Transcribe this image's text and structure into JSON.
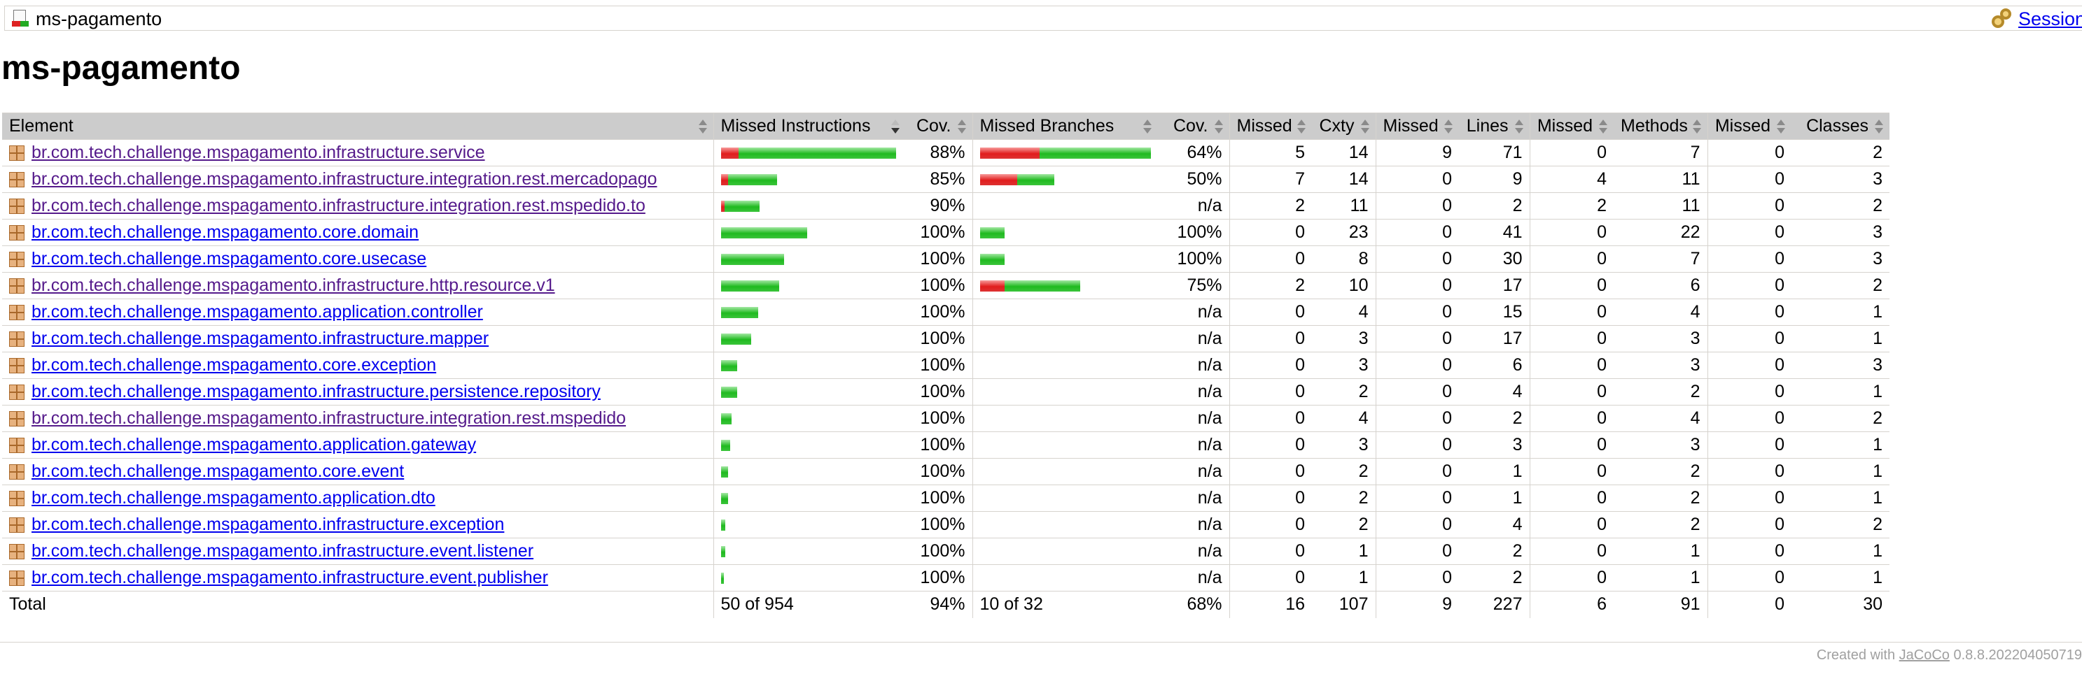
{
  "breadcrumb": {
    "title": "ms-pagamento",
    "sessions_link": "Sessions"
  },
  "page_title": "ms-pagamento",
  "table": {
    "headers": [
      "Element",
      "Missed Instructions",
      "Cov.",
      "Missed Branches",
      "Cov.",
      "Missed",
      "Cxty",
      "Missed",
      "Lines",
      "Missed",
      "Methods",
      "Missed",
      "Classes"
    ],
    "rows": [
      {
        "name": "br.com.tech.challenge.mspagamento.infrastructure.service",
        "visited": true,
        "instr_red": 0.099,
        "instr_green": 0.901,
        "instr_cov": "88%",
        "br_red": 0.35,
        "br_green": 0.65,
        "br_cov": "64%",
        "cxty_missed": "5",
        "cxty": "14",
        "lines_missed": "9",
        "lines": "71",
        "methods_missed": "0",
        "methods": "7",
        "classes_missed": "0",
        "classes": "2"
      },
      {
        "name": "br.com.tech.challenge.mspagamento.infrastructure.integration.rest.mercadopago",
        "visited": true,
        "instr_red": 0.04,
        "instr_green": 0.28,
        "instr_cov": "85%",
        "br_red": 0.21,
        "br_green": 0.21,
        "br_cov": "50%",
        "cxty_missed": "7",
        "cxty": "14",
        "lines_missed": "0",
        "lines": "9",
        "methods_missed": "4",
        "methods": "11",
        "classes_missed": "0",
        "classes": "3"
      },
      {
        "name": "br.com.tech.challenge.mspagamento.infrastructure.integration.rest.mspedido.to",
        "visited": true,
        "instr_red": 0.02,
        "instr_green": 0.2,
        "instr_cov": "90%",
        "br_red": 0,
        "br_green": 0,
        "br_cov": "n/a",
        "cxty_missed": "2",
        "cxty": "11",
        "lines_missed": "0",
        "lines": "2",
        "methods_missed": "2",
        "methods": "11",
        "classes_missed": "0",
        "classes": "2"
      },
      {
        "name": "br.com.tech.challenge.mspagamento.core.domain",
        "visited": false,
        "instr_red": 0,
        "instr_green": 0.49,
        "instr_cov": "100%",
        "br_red": 0,
        "br_green": 0.14,
        "br_cov": "100%",
        "cxty_missed": "0",
        "cxty": "23",
        "lines_missed": "0",
        "lines": "41",
        "methods_missed": "0",
        "methods": "22",
        "classes_missed": "0",
        "classes": "3"
      },
      {
        "name": "br.com.tech.challenge.mspagamento.core.usecase",
        "visited": false,
        "instr_red": 0,
        "instr_green": 0.36,
        "instr_cov": "100%",
        "br_red": 0,
        "br_green": 0.14,
        "br_cov": "100%",
        "cxty_missed": "0",
        "cxty": "8",
        "lines_missed": "0",
        "lines": "30",
        "methods_missed": "0",
        "methods": "7",
        "classes_missed": "0",
        "classes": "3"
      },
      {
        "name": "br.com.tech.challenge.mspagamento.infrastructure.http.resource.v1",
        "visited": true,
        "instr_red": 0,
        "instr_green": 0.33,
        "instr_cov": "100%",
        "br_red": 0.14,
        "br_green": 0.43,
        "br_cov": "75%",
        "cxty_missed": "2",
        "cxty": "10",
        "lines_missed": "0",
        "lines": "17",
        "methods_missed": "0",
        "methods": "6",
        "classes_missed": "0",
        "classes": "2"
      },
      {
        "name": "br.com.tech.challenge.mspagamento.application.controller",
        "visited": false,
        "instr_red": 0,
        "instr_green": 0.21,
        "instr_cov": "100%",
        "br_red": 0,
        "br_green": 0,
        "br_cov": "n/a",
        "cxty_missed": "0",
        "cxty": "4",
        "lines_missed": "0",
        "lines": "15",
        "methods_missed": "0",
        "methods": "4",
        "classes_missed": "0",
        "classes": "1"
      },
      {
        "name": "br.com.tech.challenge.mspagamento.infrastructure.mapper",
        "visited": false,
        "instr_red": 0,
        "instr_green": 0.17,
        "instr_cov": "100%",
        "br_red": 0,
        "br_green": 0,
        "br_cov": "n/a",
        "cxty_missed": "0",
        "cxty": "3",
        "lines_missed": "0",
        "lines": "17",
        "methods_missed": "0",
        "methods": "3",
        "classes_missed": "0",
        "classes": "1"
      },
      {
        "name": "br.com.tech.challenge.mspagamento.core.exception",
        "visited": false,
        "instr_red": 0,
        "instr_green": 0.09,
        "instr_cov": "100%",
        "br_red": 0,
        "br_green": 0,
        "br_cov": "n/a",
        "cxty_missed": "0",
        "cxty": "3",
        "lines_missed": "0",
        "lines": "6",
        "methods_missed": "0",
        "methods": "3",
        "classes_missed": "0",
        "classes": "3"
      },
      {
        "name": "br.com.tech.challenge.mspagamento.infrastructure.persistence.repository",
        "visited": false,
        "instr_red": 0,
        "instr_green": 0.09,
        "instr_cov": "100%",
        "br_red": 0,
        "br_green": 0,
        "br_cov": "n/a",
        "cxty_missed": "0",
        "cxty": "2",
        "lines_missed": "0",
        "lines": "4",
        "methods_missed": "0",
        "methods": "2",
        "classes_missed": "0",
        "classes": "1"
      },
      {
        "name": "br.com.tech.challenge.mspagamento.infrastructure.integration.rest.mspedido",
        "visited": true,
        "instr_red": 0,
        "instr_green": 0.06,
        "instr_cov": "100%",
        "br_red": 0,
        "br_green": 0,
        "br_cov": "n/a",
        "cxty_missed": "0",
        "cxty": "4",
        "lines_missed": "0",
        "lines": "2",
        "methods_missed": "0",
        "methods": "4",
        "classes_missed": "0",
        "classes": "2"
      },
      {
        "name": "br.com.tech.challenge.mspagamento.application.gateway",
        "visited": false,
        "instr_red": 0,
        "instr_green": 0.05,
        "instr_cov": "100%",
        "br_red": 0,
        "br_green": 0,
        "br_cov": "n/a",
        "cxty_missed": "0",
        "cxty": "3",
        "lines_missed": "0",
        "lines": "3",
        "methods_missed": "0",
        "methods": "3",
        "classes_missed": "0",
        "classes": "1"
      },
      {
        "name": "br.com.tech.challenge.mspagamento.core.event",
        "visited": false,
        "instr_red": 0,
        "instr_green": 0.04,
        "instr_cov": "100%",
        "br_red": 0,
        "br_green": 0,
        "br_cov": "n/a",
        "cxty_missed": "0",
        "cxty": "2",
        "lines_missed": "0",
        "lines": "1",
        "methods_missed": "0",
        "methods": "2",
        "classes_missed": "0",
        "classes": "1"
      },
      {
        "name": "br.com.tech.challenge.mspagamento.application.dto",
        "visited": false,
        "instr_red": 0,
        "instr_green": 0.04,
        "instr_cov": "100%",
        "br_red": 0,
        "br_green": 0,
        "br_cov": "n/a",
        "cxty_missed": "0",
        "cxty": "2",
        "lines_missed": "0",
        "lines": "1",
        "methods_missed": "0",
        "methods": "2",
        "classes_missed": "0",
        "classes": "1"
      },
      {
        "name": "br.com.tech.challenge.mspagamento.infrastructure.exception",
        "visited": false,
        "instr_red": 0,
        "instr_green": 0.025,
        "instr_cov": "100%",
        "br_red": 0,
        "br_green": 0,
        "br_cov": "n/a",
        "cxty_missed": "0",
        "cxty": "2",
        "lines_missed": "0",
        "lines": "4",
        "methods_missed": "0",
        "methods": "2",
        "classes_missed": "0",
        "classes": "2"
      },
      {
        "name": "br.com.tech.challenge.mspagamento.infrastructure.event.listener",
        "visited": false,
        "instr_red": 0,
        "instr_green": 0.025,
        "instr_cov": "100%",
        "br_red": 0,
        "br_green": 0,
        "br_cov": "n/a",
        "cxty_missed": "0",
        "cxty": "1",
        "lines_missed": "0",
        "lines": "2",
        "methods_missed": "0",
        "methods": "1",
        "classes_missed": "0",
        "classes": "1"
      },
      {
        "name": "br.com.tech.challenge.mspagamento.infrastructure.event.publisher",
        "visited": false,
        "instr_red": 0,
        "instr_green": 0.017,
        "instr_cov": "100%",
        "br_red": 0,
        "br_green": 0,
        "br_cov": "n/a",
        "cxty_missed": "0",
        "cxty": "1",
        "lines_missed": "0",
        "lines": "2",
        "methods_missed": "0",
        "methods": "1",
        "classes_missed": "0",
        "classes": "1"
      }
    ],
    "total": {
      "label": "Total",
      "instr": "50 of 954",
      "instr_cov": "94%",
      "br": "10 of 32",
      "br_cov": "68%",
      "cxty_missed": "16",
      "cxty": "107",
      "lines_missed": "9",
      "lines": "227",
      "methods_missed": "6",
      "methods": "91",
      "classes_missed": "0",
      "classes": "30"
    }
  },
  "footer": {
    "prefix": "Created with ",
    "link": "JaCoCo",
    "version": " 0.8.8.202204050719"
  },
  "colors": {
    "missed": "#e11d1d",
    "covered": "#1fba1f",
    "header_bg": "#cccccc",
    "link": "#0000ee",
    "visited_link": "#551a8b"
  }
}
